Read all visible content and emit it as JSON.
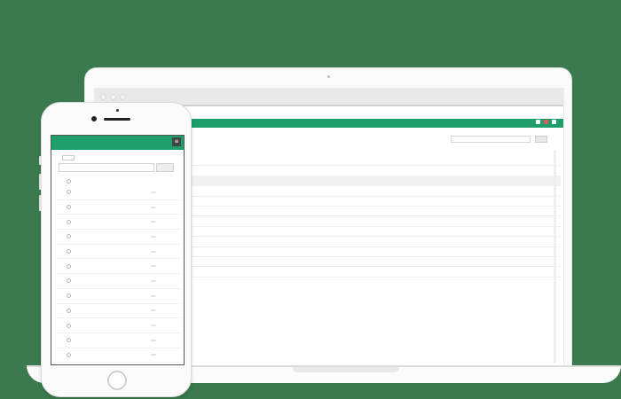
{
  "desktop": {
    "user": "",
    "search_placeholder": "",
    "search_button": "",
    "headers": [
      "",
      "",
      ""
    ],
    "rows": [
      {
        "name": "",
        "date": "",
        "edit": "",
        "view": "",
        "delete": ""
      },
      {
        "name": "",
        "date": "",
        "edit": "",
        "view": "",
        "delete": ""
      },
      {
        "name": "",
        "date": "",
        "edit": "",
        "view": "",
        "delete": ""
      },
      {
        "name": "",
        "date": "",
        "edit": "",
        "view": "",
        "delete": ""
      },
      {
        "name": "",
        "date": "",
        "edit": "",
        "view": "",
        "delete": ""
      },
      {
        "name": "",
        "date": "",
        "edit": "",
        "view": "",
        "delete": ""
      },
      {
        "name": "",
        "date": "",
        "edit": "",
        "view": "",
        "delete": ""
      },
      {
        "name": "",
        "date": "",
        "edit": "",
        "view": "",
        "delete": ""
      },
      {
        "name": "",
        "date": "",
        "edit": "",
        "view": "",
        "delete": ""
      },
      {
        "name": "",
        "date": "",
        "edit": "",
        "view": "",
        "delete": ""
      },
      {
        "name": "",
        "date": "",
        "edit": "",
        "view": "",
        "delete": ""
      },
      {
        "name": "",
        "date": "",
        "edit": "",
        "view": "",
        "delete": ""
      }
    ]
  },
  "mobile": {
    "title": "",
    "tag": "",
    "search_placeholder": "",
    "search_button": "",
    "headers": [
      "",
      "",
      ""
    ],
    "rows": [
      {
        "name": "",
        "type": "",
        "edit": ""
      },
      {
        "name": "",
        "type": "",
        "edit": ""
      },
      {
        "name": "",
        "type": "",
        "edit": ""
      },
      {
        "name": "",
        "type": "",
        "edit": ""
      },
      {
        "name": "",
        "type": "",
        "edit": ""
      },
      {
        "name": "",
        "type": "",
        "edit": ""
      },
      {
        "name": "",
        "type": "",
        "edit": ""
      },
      {
        "name": "",
        "type": "",
        "edit": ""
      },
      {
        "name": "",
        "type": "",
        "edit": ""
      },
      {
        "name": "",
        "type": "",
        "edit": ""
      },
      {
        "name": "",
        "type": "",
        "edit": ""
      },
      {
        "name": "",
        "type": "",
        "edit": ""
      }
    ]
  },
  "colors": {
    "background": "#3a7a4e",
    "accent_green": "#1e9e6a",
    "link_blue": "#2f8fd8",
    "delete_red": "#d93838"
  },
  "icons": [
    "menu-icon",
    "user-icon",
    "notification-icon",
    "checkbox-icon",
    "camera-icon",
    "home-button-icon"
  ]
}
